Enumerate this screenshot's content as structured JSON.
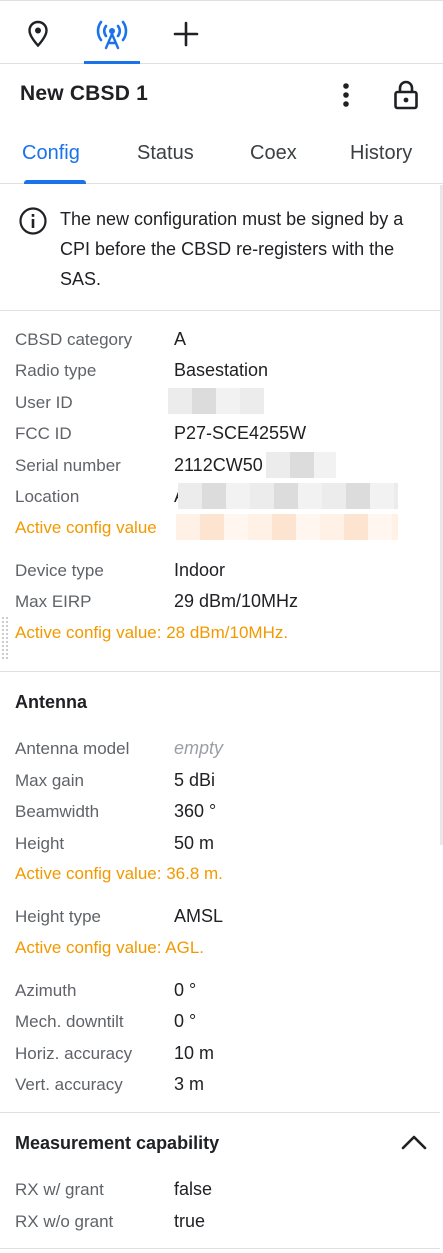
{
  "toolbar": {
    "items": [
      {
        "icon": "map-pin-icon"
      },
      {
        "icon": "radio-tower-icon",
        "active": true
      },
      {
        "icon": "plus-icon"
      }
    ],
    "accent_color": "#1a73e8"
  },
  "header": {
    "title": "New CBSD 1",
    "more_icon": "more-vert-icon",
    "lock_icon": "lock-icon"
  },
  "tabs": [
    {
      "label": "Config",
      "active": true
    },
    {
      "label": "Status"
    },
    {
      "label": "Coex"
    },
    {
      "label": "History"
    }
  ],
  "notice": {
    "icon": "info-icon",
    "text": "The new configuration must be signed by a CPI before the CBSD re-registers with the SAS."
  },
  "general": {
    "cbsd_category": {
      "label": "CBSD category",
      "value": "A"
    },
    "radio_type": {
      "label": "Radio type",
      "value": "Basestation"
    },
    "user_id": {
      "label": "User ID",
      "value": ""
    },
    "fcc_id": {
      "label": "FCC ID",
      "value": "P27-SCE4255W"
    },
    "serial_number": {
      "label": "Serial number",
      "value": "2112CW50"
    },
    "location": {
      "label": "Location",
      "value": "A",
      "active_note": "Active config value"
    },
    "device_type": {
      "label": "Device type",
      "value": "Indoor"
    },
    "max_eirp": {
      "label": "Max EIRP",
      "value": "29 dBm/10MHz",
      "active_note": "Active config value: 28 dBm/10MHz."
    }
  },
  "antenna": {
    "title": "Antenna",
    "model": {
      "label": "Antenna model",
      "value": "empty"
    },
    "max_gain": {
      "label": "Max gain",
      "value": "5 dBi"
    },
    "beamwidth": {
      "label": "Beamwidth",
      "value": "360 °"
    },
    "height": {
      "label": "Height",
      "value": "50 m",
      "active_note": "Active config value: 36.8 m."
    },
    "height_type": {
      "label": "Height type",
      "value": "AMSL",
      "active_note": "Active config value: AGL."
    },
    "azimuth": {
      "label": "Azimuth",
      "value": "0 °"
    },
    "downtilt": {
      "label": "Mech. downtilt",
      "value": "0 °"
    },
    "horiz_accuracy": {
      "label": "Horiz. accuracy",
      "value": "10 m"
    },
    "vert_accuracy": {
      "label": "Vert. accuracy",
      "value": "3 m"
    }
  },
  "measurement": {
    "title": "Measurement capability",
    "collapse_icon": "chevron-up-icon",
    "rx_with_grant": {
      "label": "RX w/ grant",
      "value": "false"
    },
    "rx_without_grant": {
      "label": "RX w/o grant",
      "value": "true"
    }
  },
  "colors": {
    "warning": "#f29900",
    "label": "#5f6368",
    "text": "#202124"
  }
}
